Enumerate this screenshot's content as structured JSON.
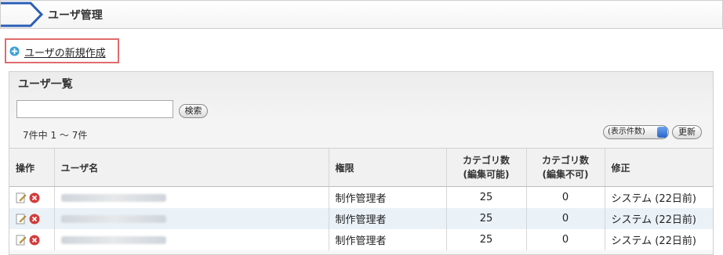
{
  "header": {
    "title": "ユーザ管理"
  },
  "actions": {
    "new_user_label": "ユーザの新規作成"
  },
  "panel": {
    "title": "ユーザ一覧",
    "search": {
      "value": "",
      "button_label": "検索"
    },
    "count_text": "7件中 1 〜 7件",
    "per_page_label": "(表示件数)",
    "update_button_label": "更新"
  },
  "table": {
    "headers": {
      "ops": "操作",
      "user_name": "ユーザ名",
      "permission": "権限",
      "cat_editable_1": "カテゴリ数",
      "cat_editable_2": "(編集可能)",
      "cat_readonly_1": "カテゴリ数",
      "cat_readonly_2": "(編集不可)",
      "modified": "修正"
    },
    "rows": [
      {
        "permission": "制作管理者",
        "editable": "25",
        "readonly": "0",
        "modified": "システム (22日前)"
      },
      {
        "permission": "制作管理者",
        "editable": "25",
        "readonly": "0",
        "modified": "システム (22日前)"
      },
      {
        "permission": "制作管理者",
        "editable": "25",
        "readonly": "0",
        "modified": "システム (22日前)"
      }
    ]
  },
  "colors": {
    "accent": "#2b5fb4",
    "highlight_border": "#e06b6b",
    "row_alt": "#eaf2f8"
  },
  "icons": {
    "header": "chevron-icon",
    "new_user": "plus-circle-icon",
    "edit": "edit-icon",
    "delete": "delete-icon",
    "dropdown": "dropdown-arrow-icon"
  }
}
